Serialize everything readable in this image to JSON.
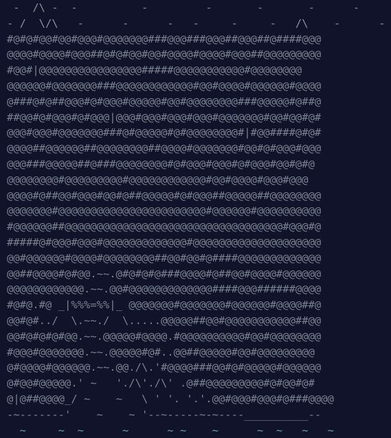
{
  "colors": {
    "background": "#10132a",
    "rock": "#7c8190",
    "moss": "#56a33c",
    "sea": "#62a4b8"
  },
  "art": {
    "lines": [
      " -  /\\ -  -          -         -       -       -      -",
      "- /  \\/\\   -      -      -   -     -     -   /\\    -      -",
      "#@#@#@@#@@#@@@#@@@@@@@###@@@###@@@##@@@##@####@@@",
      "@@@@#@@@@#@@@##@#@#@@#@@#@@@@#@@@@#@@@##@@@@@@@@@",
      "#@@#|@@@@@@@@@@@@@@@@#####@@@@@@@@@@@#@@@@@@@@",
      "@@@@@@#@@@@@@@###@@@@@@@@@@@@#@@#@@@@#@@@@@@#@@@@",
      "@###@#@##@@@#@#@@@#@@@@@#@@#@@@@@@@@###@@@@@#@##@",
      "##@@#@#@@@#@#@@@|@@@#@@@#@@@#@@@#@@@@@@@#@@#@@#@#",
      "@@@#@@@#@@@@@@@###@#@@@@@#@#@@@@@@@@#|#@@####@#@#",
      "@@@@##@@@@@@##@@@@@@@@##@@@@#@@@@@@@#@@#@#@@@#@@@",
      "@@@###@@@@@##@###@@@@@@@@#@#@@@#@@@#@#@@@#@@#@#@",
      "@@@@@@@@#@@@@@@@@@#@@@@@@@@@@@@#@@#@@@@#@@@#@@@",
      "@@@@#@##@@#@@@#@@#@##@@@@@#@#@@@##@@@@@##@@@@@@@@",
      "@@@@@@@#@@@@@@@@@@@@@@@@@@@@@@@#@@@@@@#@@@@@@@@@@",
      "#@@@@@@##@@@@@@@@@@@@@@@@@@@@@@@@@@@@@@@@@@#@@@#@",
      "#####@#@@@#@@@#@@@@@@@@@@@@@#@@@@@@@@@@@@@@@@@@@@",
      "@@#@@@@@@#@@@@#@@@@@@@@##@@#@@#@####@@@@@@@@@@@@@",
      "@@##@@@@#@#@@.~~.@#@#@#@###@@@@#@##@@#@@@@#@@@@@@",
      "@@@@@@@@@@@@.~~.@@#@@@@@@@@@@@@@####@@@######@@@@",
      "#@#@.#@ _|%%%=%%|_ @@@@@@@#@@@@@@@#@@@@@@#@@@@##@",
      "@@#@#../  \\.~~./  \\.....@@@@@##@@#@@@@@@@@@@@##@@",
      "@@#@#@#@#@@.~~.@@@@@#@@@@.#@@@@@@@@@@#@@#@@@@@@@@",
      "#@@@#@@@@@@@.~~.@@@@@#@#..@@##@@@@@#@@#@@@@@@@@@",
      "@#@@@@#@@@@@@.~~.@@./\\.'#@@@@###@@#@#@@@@@#@@@@@@",
      "@#@@#@@@@@.' ~   './\\'./\\' .@##@@@@@@@@@#@#@@#@#",
      "@|@##@@@@_/ ~    ~   \\ ' '. '.'.@@#@@@#@@@#@###@@@@",
      "-~-------'    ~    ~ '--~-----~-~----__________--",
      "  ~     ~  ~      ~      ~ ~    ~      ~  ~   ~   ~"
    ]
  }
}
